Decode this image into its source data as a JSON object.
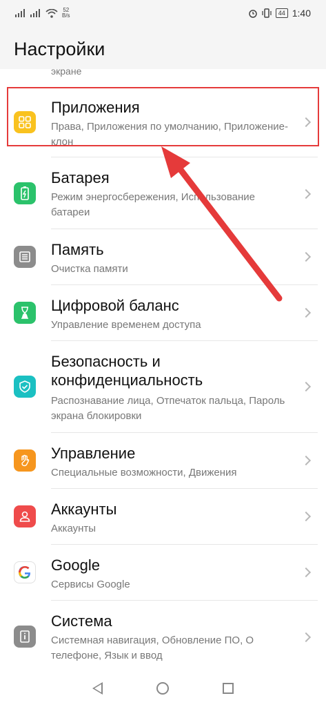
{
  "status_bar": {
    "speed_value": "52",
    "speed_unit": "B/s",
    "battery": "44",
    "time": "1:40"
  },
  "header": {
    "title": "Настройки"
  },
  "clipped_text": "экране",
  "items": [
    {
      "title": "Приложения",
      "subtitle": "Права, Приложения по умолчанию, Приложение-клон",
      "icon": "apps-grid-icon",
      "color": "#f9c21f"
    },
    {
      "title": "Батарея",
      "subtitle": "Режим энергосбережения, Использование батареи",
      "icon": "battery-icon",
      "color": "#2bc26b"
    },
    {
      "title": "Память",
      "subtitle": "Очистка памяти",
      "icon": "storage-icon",
      "color": "#8c8c8c"
    },
    {
      "title": "Цифровой баланс",
      "subtitle": "Управление временем доступа",
      "icon": "hourglass-icon",
      "color": "#2bc26b"
    },
    {
      "title": "Безопасность и конфиденциальность",
      "subtitle": "Распознавание лица, Отпечаток пальца, Пароль экрана блокировки",
      "icon": "shield-icon",
      "color": "#1bc0c2"
    },
    {
      "title": "Управление",
      "subtitle": "Специальные возможности, Движения",
      "icon": "hand-icon",
      "color": "#f6961e"
    },
    {
      "title": "Аккаунты",
      "subtitle": "Аккаунты",
      "icon": "account-icon",
      "color": "#ef4b4b"
    },
    {
      "title": "Google",
      "subtitle": "Сервисы Google",
      "icon": "google-icon",
      "color": "#ffffff"
    },
    {
      "title": "Система",
      "subtitle": "Системная навигация, Обновление ПО, О телефоне, Язык и ввод",
      "icon": "system-info-icon",
      "color": "#8c8c8c"
    }
  ],
  "annotation": {
    "color": "#e53a3a"
  }
}
